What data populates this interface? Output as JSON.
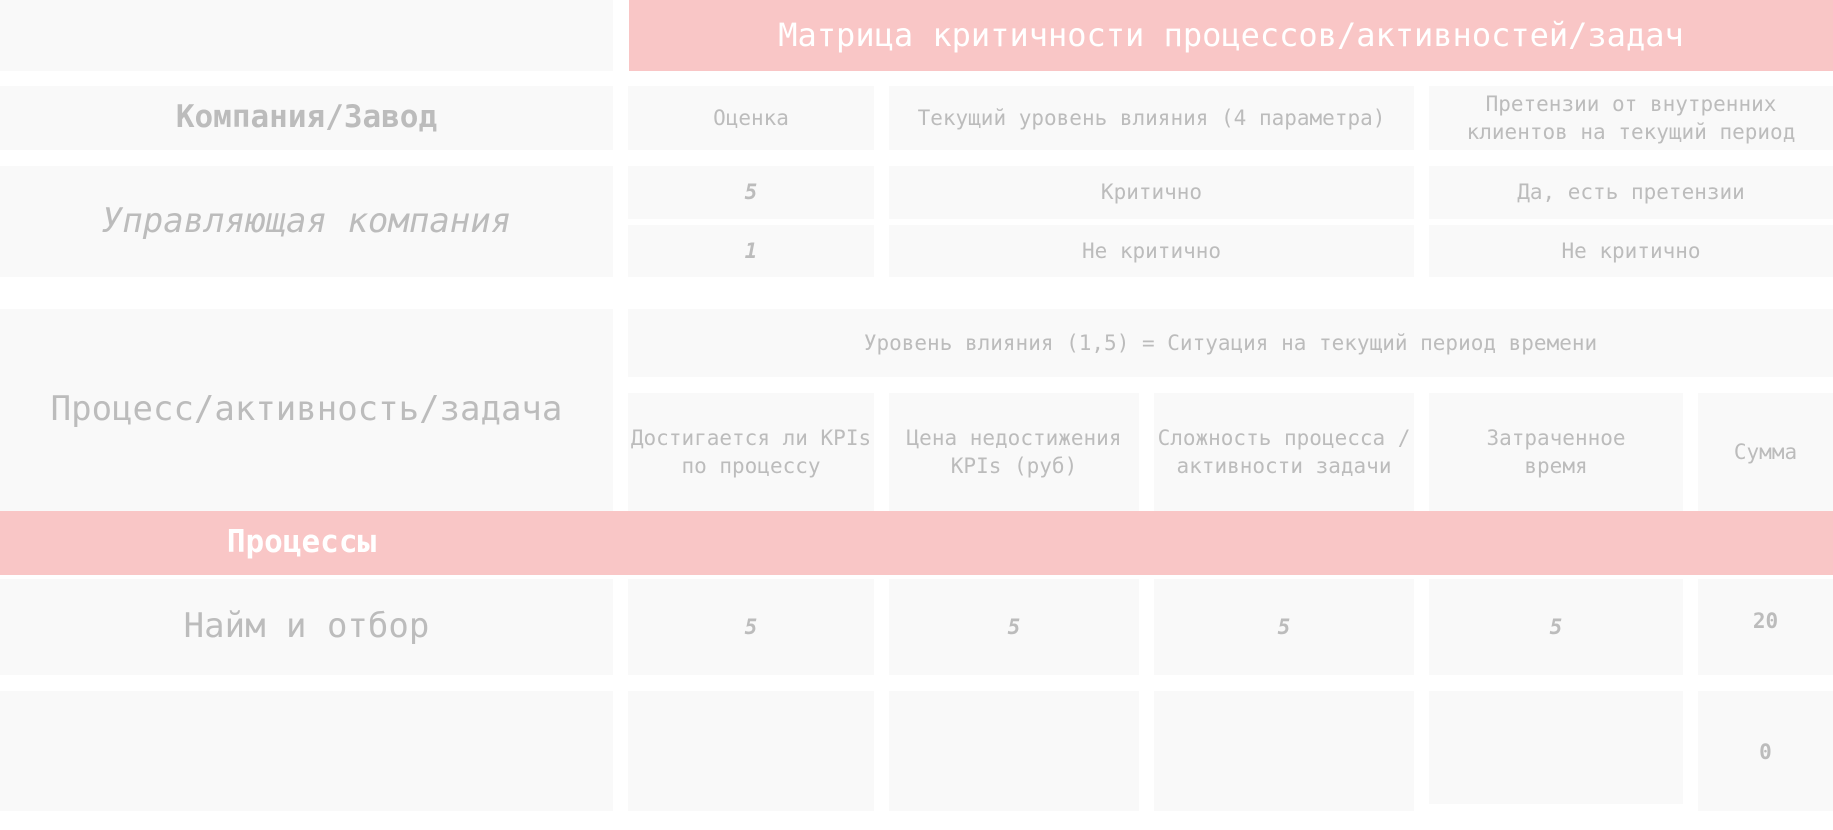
{
  "title": "Матрица критичности процессов/активностей/задач",
  "company": {
    "label": "Компания/Завод",
    "name": "Управляющая компания"
  },
  "header": {
    "score": "Оценка",
    "impact_level": "Текущий уровень влияния (4 параметра)",
    "claims": "Претензии от внутренних клиентов на текущий период"
  },
  "legend": [
    {
      "score": "5",
      "impact": "Критично",
      "claims": "Да, есть претензии"
    },
    {
      "score": "1",
      "impact": "Не критично",
      "claims": "Не критично"
    }
  ],
  "process_label": "Процесс/активность/задача",
  "impact_note": "Уровень влияния (1,5) = Ситуация на текущий период времени",
  "columns": [
    "Достигается ли KPIs по процессу",
    "Цена недостижения KPIs (руб)",
    "Сложность процесса /активности задачи",
    "Затраченное время",
    "Сумма"
  ],
  "section": "Процессы",
  "rows": [
    {
      "name": "Найм и отбор",
      "values": [
        "5",
        "5",
        "5",
        "5"
      ],
      "sum": "20"
    },
    {
      "name": "",
      "values": [
        "",
        "",
        "",
        ""
      ],
      "sum": "0"
    }
  ]
}
